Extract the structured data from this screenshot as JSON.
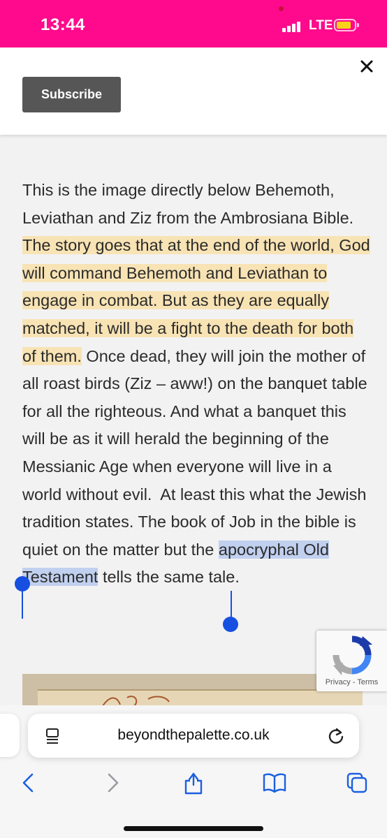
{
  "status_bar": {
    "time": "13:44",
    "network": "LTE",
    "background_color": "#ff0a8c",
    "battery_color": "#f7d21a"
  },
  "subscribe_panel": {
    "subscribe_label": "Subscribe",
    "close_icon": "close-icon"
  },
  "article": {
    "text_before_highlight": "This is the image directly below Behemoth, Leviathan and Ziz from the Ambrosiana Bible. ",
    "highlighted_text": "The story goes that at the end of the world, God will command Behemoth and Leviathan to engage in combat. But as they are equally matched, it will be a fight to the death for both of them.",
    "text_after_highlight": " Once dead, they will join the mother of all roast birds (Ziz – aww!) on the banquet table for all the righteous. And what a banquet this will be as it will herald the beginning of the Messianic Age when everyone will live in a world without evil.  At least this what the Jewish tradition states. The book of Job in the bible is quiet on the matter but the ",
    "selected_text": "apocryphal Old Testament",
    "text_after_selection": " tells the same tale.",
    "highlight_color": "#f8e3b4",
    "selection_color": "#c1d0ef",
    "selection_handle_color": "#1750e0"
  },
  "recaptcha": {
    "privacy_label": "Privacy",
    "separator": "-",
    "terms_label": "Terms"
  },
  "browser": {
    "url": "beyondthepalette.co.uk",
    "icons": {
      "reader": "reader-icon",
      "reload": "reload-icon",
      "back": "back-icon",
      "forward": "forward-icon",
      "share": "share-icon",
      "bookmarks": "bookmarks-icon",
      "tabs": "tabs-icon"
    }
  }
}
